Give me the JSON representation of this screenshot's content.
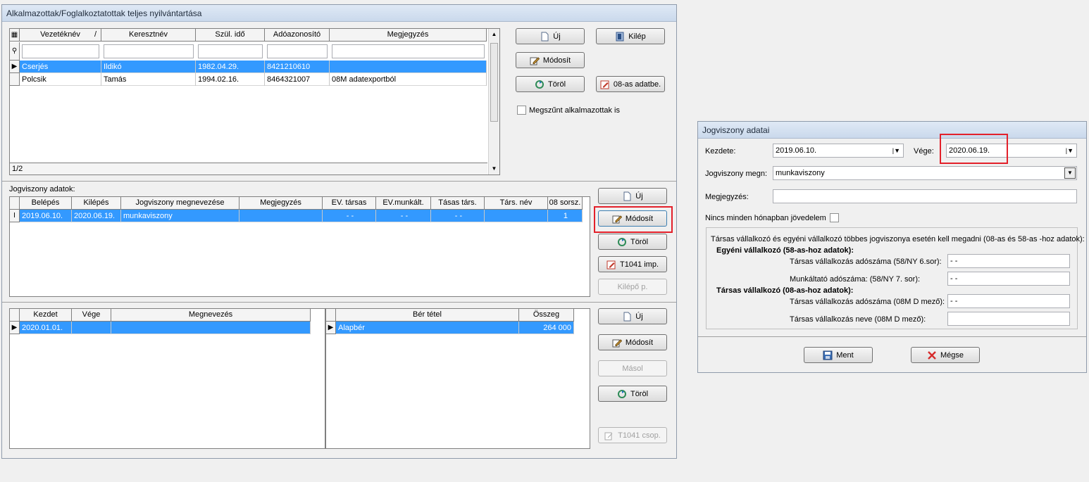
{
  "main_window": {
    "title": "Alkalmazottak/Foglalkoztatottak teljes nyilvántartása",
    "employees": {
      "columns": [
        "Vezetéknév",
        "Keresztnév",
        "Szül. idő",
        "Adóazonosító",
        "Megjegyzés"
      ],
      "sort_mark": "/",
      "rows": [
        {
          "last": "Cserjés",
          "first": "Ildikó",
          "born": "1982.04.29.",
          "tax_id": "8421210610",
          "note": ""
        },
        {
          "last": "Polcsik",
          "first": "Tamás",
          "born": "1994.02.16.",
          "tax_id": "8464321007",
          "note": "08M adatexportból"
        }
      ],
      "counter": "1/2"
    },
    "top_buttons": {
      "new": "Új",
      "exit": "Kilép",
      "modify": "Módosít",
      "delete": "Töröl",
      "import08": "08-as adatbe."
    },
    "show_terminated_label": "Megszűnt alkalmazottak is",
    "jogviszony": {
      "section_label": "Jogviszony adatok:",
      "columns": [
        "Belépés",
        "Kilépés",
        "Jogviszony megnevezése",
        "Megjegyzés",
        "EV. társas",
        "EV.munkált.",
        "Tásas társ.",
        "Társ. név",
        "08 sorsz."
      ],
      "row": {
        "entry": "2019.06.10.",
        "exit": "2020.06.19.",
        "name": "munkaviszony",
        "note": "",
        "ev_tarsas": "- -",
        "ev_munkalt": "- -",
        "tasas_tars": "- -",
        "tars_nev": "",
        "sorsz": "1"
      },
      "buttons": {
        "new": "Új",
        "modify": "Módosít",
        "delete": "Töröl",
        "t1041": "T1041 imp.",
        "kilepo": "Kilépő p."
      }
    },
    "periods": {
      "columns": [
        "Kezdet",
        "Vége",
        "Megnevezés"
      ],
      "row": {
        "start": "2020.01.01.",
        "end": "",
        "name": ""
      }
    },
    "wages": {
      "columns": [
        "Bér tétel",
        "Összeg"
      ],
      "row": {
        "item": "Alapbér",
        "amount": "264 000"
      }
    },
    "bottom_buttons": {
      "new": "Új",
      "modify": "Módosít",
      "copy": "Másol",
      "delete": "Töröl",
      "t1041csop": "T1041 csop."
    }
  },
  "dialog": {
    "title": "Jogviszony adatai",
    "start_label": "Kezdete:",
    "start_value": "2019.06.10.",
    "end_label": "Vége:",
    "end_value": "2020.06.19.",
    "type_label": "Jogviszony megn:",
    "type_value": "munkaviszony",
    "note_label": "Megjegyzés:",
    "note_value": "",
    "no_income_label": "Nincs minden hónapban jövedelem",
    "group_text": "Társas vállalkozó és egyéni vállalkozó többes jogviszonya esetén kell megadni (08-as és 58-as -hoz adatok):",
    "ev_heading": "Egyéni vállalkozó (58-as-hoz adatok):",
    "ev_tax_label": "Társas vállalkozás adószáma (58/NY 6.sor):",
    "ev_tax_value": "- -",
    "ev_employer_label": "Munkáltató adószáma: (58/NY 7. sor):",
    "ev_employer_value": "- -",
    "tv_heading": "Társas vállalkozó (08-as-hoz adatok):",
    "tv_tax_label": "Társas vállalkozás adószáma (08M D mező):",
    "tv_tax_value": "- -",
    "tv_name_label": "Társas vállalkozás neve (08M D mező):",
    "tv_name_value": "",
    "save": "Ment",
    "cancel": "Mégse"
  }
}
